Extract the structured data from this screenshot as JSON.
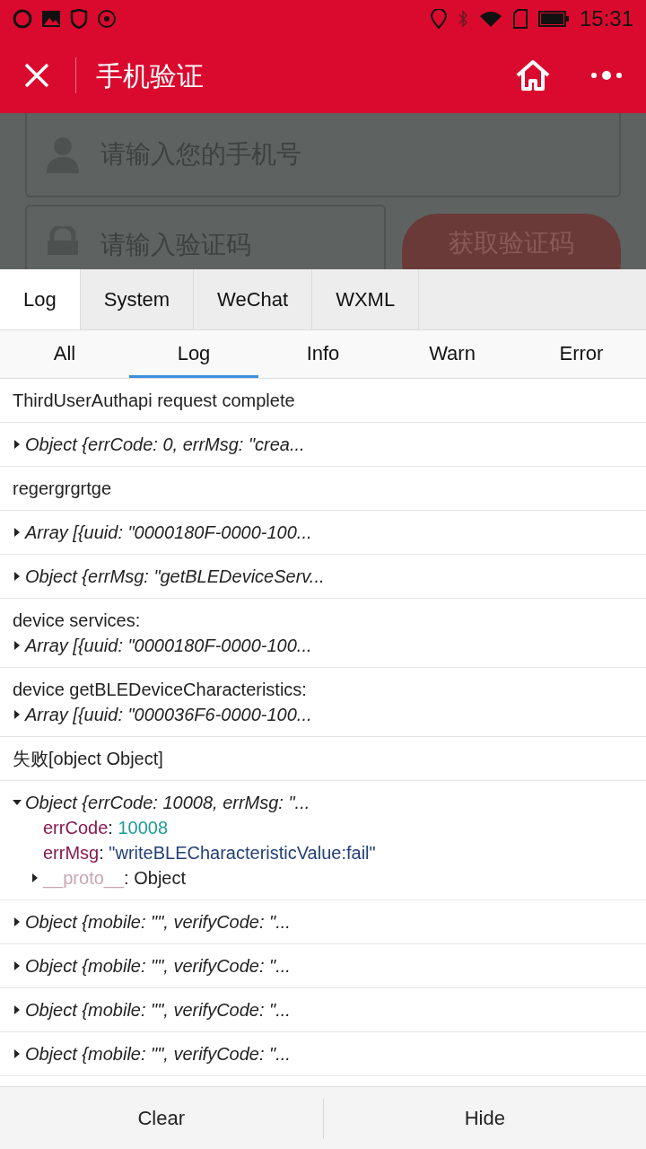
{
  "status_bar": {
    "time": "15:31"
  },
  "nav": {
    "title": "手机验证"
  },
  "form": {
    "phone": {
      "placeholder": "请输入您的手机号"
    },
    "code": {
      "placeholder": "请输入验证码"
    },
    "button": "获取验证码"
  },
  "console": {
    "tabs": [
      {
        "label": "Log",
        "selected": true
      },
      {
        "label": "System",
        "selected": false
      },
      {
        "label": "WeChat",
        "selected": false
      },
      {
        "label": "WXML",
        "selected": false
      }
    ],
    "filters": [
      {
        "label": "All",
        "selected": false
      },
      {
        "label": "Log",
        "selected": true
      },
      {
        "label": "Info",
        "selected": false
      },
      {
        "label": "Warn",
        "selected": false
      },
      {
        "label": "Error",
        "selected": false
      }
    ],
    "entries": [
      {
        "kind": "text",
        "text": "ThirdUserAuthapi request complete"
      },
      {
        "kind": "object",
        "expanded": false,
        "summary": "Object {errCode: 0, errMsg: \"crea..."
      },
      {
        "kind": "text",
        "text": "regergrgrtge"
      },
      {
        "kind": "object",
        "expanded": false,
        "summary": "Array [{uuid: \"0000180F-0000-100..."
      },
      {
        "kind": "object",
        "expanded": false,
        "summary": "Object {errMsg: \"getBLEDeviceServ..."
      },
      {
        "kind": "object",
        "label": "device services:",
        "expanded": false,
        "summary": "Array [{uuid: \"0000180F-0000-100..."
      },
      {
        "kind": "object",
        "label": "device getBLEDeviceCharacteristics:",
        "expanded": false,
        "summary": "Array [{uuid: \"000036F6-0000-100..."
      },
      {
        "kind": "text",
        "text": "失败[object Object]"
      },
      {
        "kind": "object",
        "expanded": true,
        "summary": "Object {errCode: 10008, errMsg: \"...",
        "props": [
          {
            "kind": "number",
            "key": "errCode",
            "separator": ":",
            "value": "10008"
          },
          {
            "kind": "string",
            "key": "errMsg",
            "separator": ":",
            "value": "\"writeBLECharacteristicValue:fail\""
          },
          {
            "kind": "proto",
            "key": "__proto__",
            "separator": ":",
            "value": "Object",
            "expanded": false
          }
        ]
      },
      {
        "kind": "object",
        "expanded": false,
        "summary": "Object {mobile: \"\", verifyCode: \"..."
      },
      {
        "kind": "object",
        "expanded": false,
        "summary": "Object {mobile: \"\", verifyCode: \"..."
      },
      {
        "kind": "object",
        "expanded": false,
        "summary": "Object {mobile: \"\", verifyCode: \"..."
      },
      {
        "kind": "object",
        "expanded": false,
        "summary": "Object {mobile: \"\", verifyCode: \"..."
      }
    ],
    "actions": [
      "Clear",
      "Hide"
    ]
  }
}
